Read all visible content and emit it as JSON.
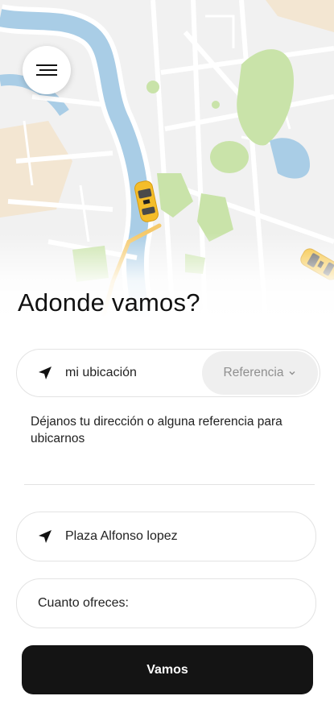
{
  "screen": {
    "title": "Adonde vamos?"
  },
  "map": {
    "menu_icon": "menu-icon",
    "car_icon": "taxi-car-icon",
    "colors": {
      "water": "#a9cde6",
      "river_bank": "#ffffff",
      "park": "#c9e3a9",
      "route": "#f5c96b",
      "car": "#f4bd2a",
      "land": "#f0f0f0",
      "sand": "#f3e6d2"
    }
  },
  "origin": {
    "icon": "navigation-arrow-icon",
    "value": "mi ubicación",
    "reference_label": "Referencia",
    "reference_icon": "chevron-down-icon"
  },
  "hint": "Déjanos tu dirección o alguna referencia para ubicarnos",
  "destination": {
    "icon": "navigation-arrow-icon",
    "value": "Plaza Alfonso lopez"
  },
  "offer": {
    "placeholder": "Cuanto ofreces:"
  },
  "submit": {
    "label": "Vamos"
  }
}
